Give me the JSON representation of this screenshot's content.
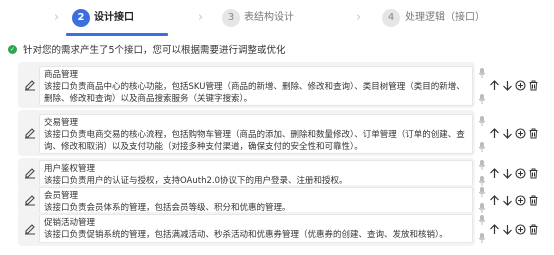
{
  "steps": [
    {
      "number": "2",
      "label": "设计接口",
      "state": "active"
    },
    {
      "number": "3",
      "label": "表结构设计",
      "state": "inactive"
    },
    {
      "number": "4",
      "label": "处理逻辑（接口）",
      "state": "inactive"
    }
  ],
  "notice": {
    "text": "针对您的需求产生了5个接口，您可以根据需要进行调整或优化"
  },
  "interfaces": [
    {
      "title": "商品管理",
      "description": "该接口负责商品中心的核心功能，包括SKU管理（商品的新增、删除、修改和查询）、类目树管理（类目的新增、删除、修改和查询）以及商品搜索服务（关键字搜索）。"
    },
    {
      "title": "交易管理",
      "description": "该接口负责电商交易的核心流程，包括购物车管理（商品的添加、删除和数量修改）、订单管理（订单的创建、查询、修改和取消）以及支付功能（对接多种支付渠道，确保支付的安全性和可靠性）。"
    },
    {
      "title": "用户鉴权管理",
      "description": "该接口负责用户的认证与授权，支持OAuth2.0协议下的用户登录、注册和授权。"
    },
    {
      "title": "会员管理",
      "description": "该接口负责会员体系的管理，包括会员等级、积分和优惠的管理。"
    },
    {
      "title": "促销活动管理",
      "description": "该接口负责促销系统的管理，包括满减活动、秒杀活动和优惠券管理（优惠券的创建、查询、发放和核销）。"
    }
  ],
  "colors": {
    "accent": "#3b6fe0",
    "success": "#2ea44f",
    "card_bg": "#f3f3f3"
  },
  "icons": {
    "edit": "edit-icon",
    "mic": "microphone-icon",
    "up": "arrow-up-icon",
    "down": "arrow-down-icon",
    "add": "plus-circle-icon",
    "delete": "trash-icon",
    "check": "check-circle-icon"
  }
}
